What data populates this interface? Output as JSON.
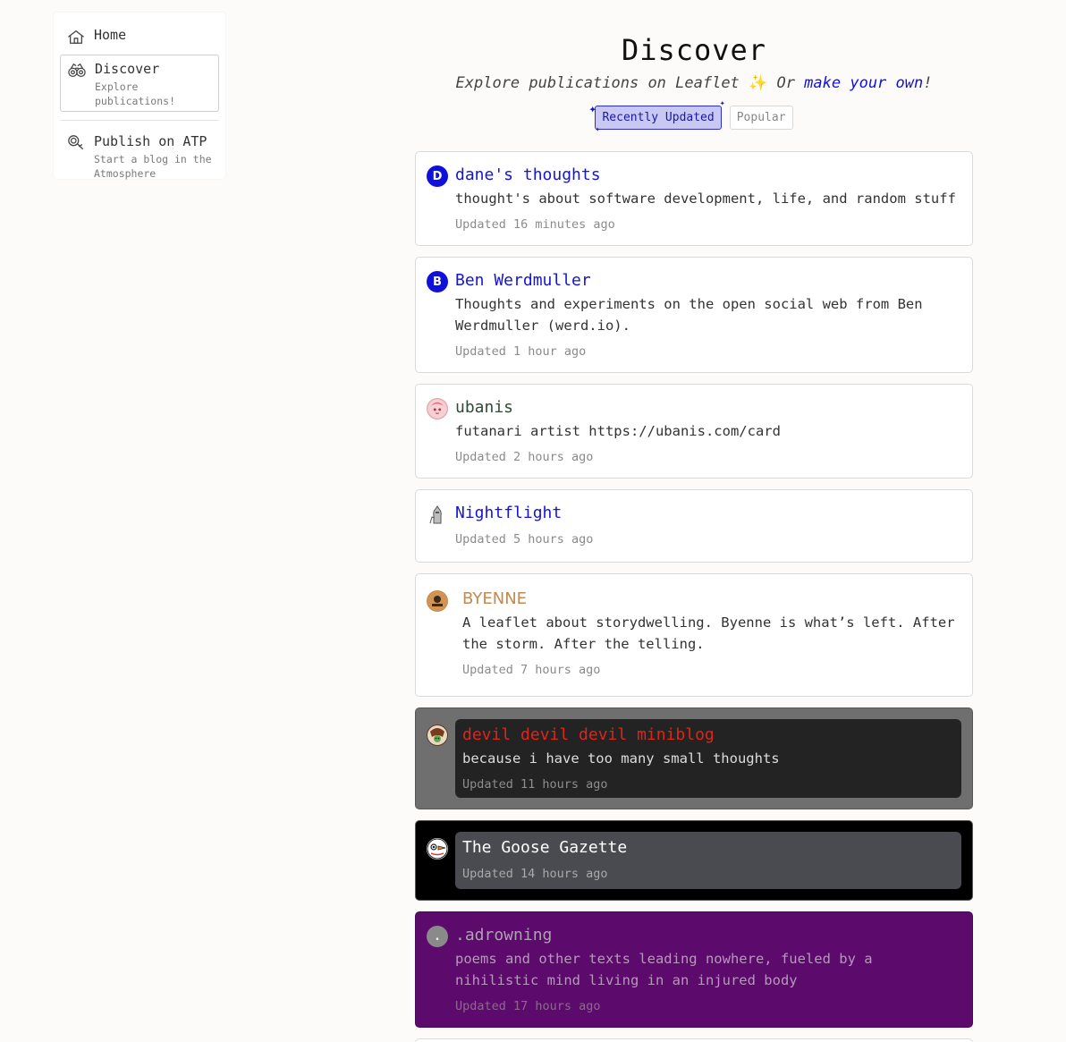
{
  "sidebar": {
    "home": {
      "label": "Home"
    },
    "discover": {
      "label": "Discover",
      "sub": "Explore publications!"
    },
    "publish": {
      "label": "Publish on ATP",
      "sub": "Start a blog in the Atmosphere"
    }
  },
  "header": {
    "title": "Discover",
    "subtitle_prefix": "Explore publications on Leaflet",
    "sparkle": "✨",
    "subtitle_mid": " Or ",
    "subtitle_link": "make your own",
    "subtitle_suffix": "!",
    "tabs": [
      {
        "label": "Recently Updated",
        "active": true
      },
      {
        "label": "Popular",
        "active": false
      }
    ]
  },
  "publications": [
    {
      "name": "dane's thoughts",
      "avatar_letter": "D",
      "description": "thought's about software development, life, and random stuff",
      "updated": "Updated 16 minutes ago"
    },
    {
      "name": "Ben Werdmuller",
      "avatar_letter": "B",
      "description": "Thoughts and experiments on the open social web from Ben Werdmuller (werd.io).",
      "updated": "Updated 1 hour ago"
    },
    {
      "name": "ubanis",
      "description": "futanari artist https://ubanis.com/card",
      "updated": "Updated 2 hours ago"
    },
    {
      "name": "Nightflight",
      "updated": "Updated 5 hours ago"
    },
    {
      "name": "BYENNE",
      "description": "A leaflet about storydwelling. Byenne is what’s left. After the storm. After the telling.",
      "updated": "Updated 7 hours ago"
    },
    {
      "name": "devil devil devil miniblog",
      "description": "because i have too many small thoughts",
      "updated": "Updated 11 hours ago"
    },
    {
      "name": "The Goose Gazette",
      "updated": "Updated 14 hours ago"
    },
    {
      "name": ".adrowning",
      "avatar_letter": ".",
      "description": "poems and other texts leading nowhere, fueled by a nihilistic mind living in an injured body",
      "updated": "Updated 17 hours ago"
    }
  ],
  "colors": {
    "accent": "#1010dd",
    "link_blue": "#1a1ad6",
    "ubanis_green": "#2f4a36",
    "byenne_tan": "#c28a50",
    "devil_red": "#e0241a",
    "adrowning_purple": "#5c0a6b"
  }
}
